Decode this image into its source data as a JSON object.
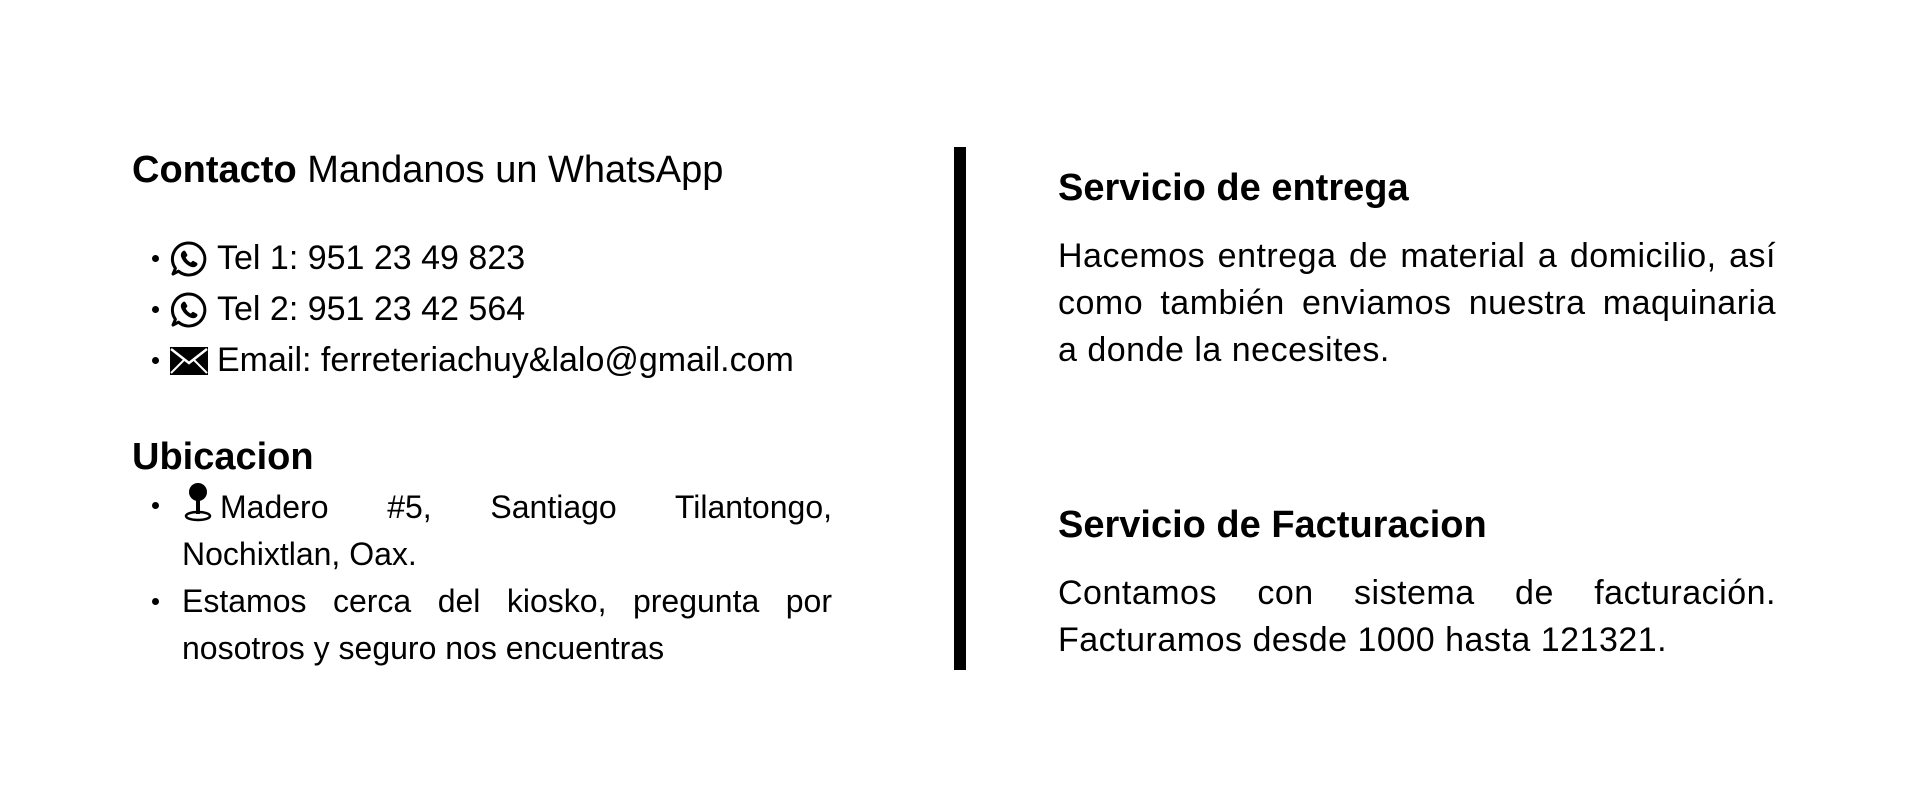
{
  "contact": {
    "heading_bold": "Contacto",
    "heading_text": "Mandanos un WhatsApp",
    "items": [
      {
        "icon": "whatsapp-icon",
        "text": "Tel 1: 951 23 49 823"
      },
      {
        "icon": "whatsapp-icon",
        "text": "Tel 2: 951 23 42 564"
      },
      {
        "icon": "envelope-icon",
        "text": "Email: ferreteriachuy&lalo@gmail.com"
      }
    ]
  },
  "location": {
    "heading": "Ubicacion",
    "items": [
      {
        "icon": "map-pin-icon",
        "text": "Madero #5, Santiago Tilantongo, Nochixtlan, Oax."
      },
      {
        "text": "Estamos cerca del kiosko, pregunta por nosotros y seguro nos encuentras"
      }
    ]
  },
  "services": [
    {
      "title": "Servicio de entrega",
      "text": "Hacemos entrega de material a domicilio, así como también enviamos nuestra maquinaria a donde la necesites."
    },
    {
      "title": "Servicio de Facturacion",
      "text": "Contamos con sistema de facturación. Facturamos desde 1000 hasta 121321."
    }
  ],
  "colors": {
    "text": "#000000",
    "background": "#ffffff",
    "divider": "#000000"
  }
}
